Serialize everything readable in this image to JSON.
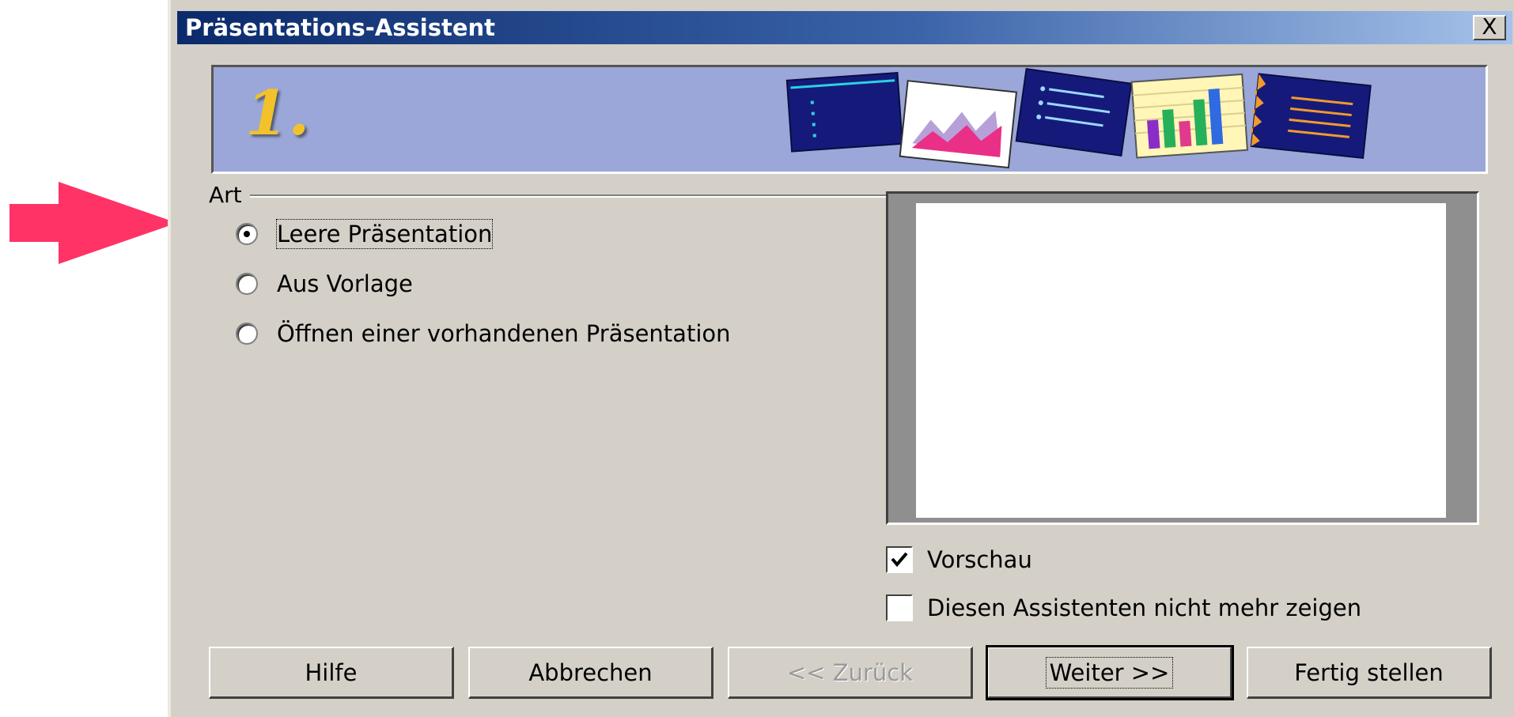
{
  "dialog": {
    "title": "Präsentations-Assistent",
    "close_label": "X"
  },
  "banner": {
    "step": "1."
  },
  "type_group": {
    "label": "Art",
    "options": [
      {
        "label": "Leere Präsentation",
        "checked": true
      },
      {
        "label": "Aus Vorlage",
        "checked": false
      },
      {
        "label": "Öffnen einer vorhandenen Präsentation",
        "checked": false
      }
    ]
  },
  "options": {
    "preview_label": "Vorschau",
    "preview_checked": true,
    "dont_show_label": "Diesen Assistenten nicht mehr zeigen",
    "dont_show_checked": false
  },
  "buttons": {
    "help": "Hilfe",
    "cancel": "Abbrechen",
    "back": "<< Zurück",
    "next": "Weiter >>",
    "finish": "Fertig stellen"
  },
  "colors": {
    "annotation_arrow": "#ff3366",
    "dialog_background": "#d4d0c8",
    "banner_background": "#9aa7d8",
    "step_number": "#f2c22b"
  }
}
